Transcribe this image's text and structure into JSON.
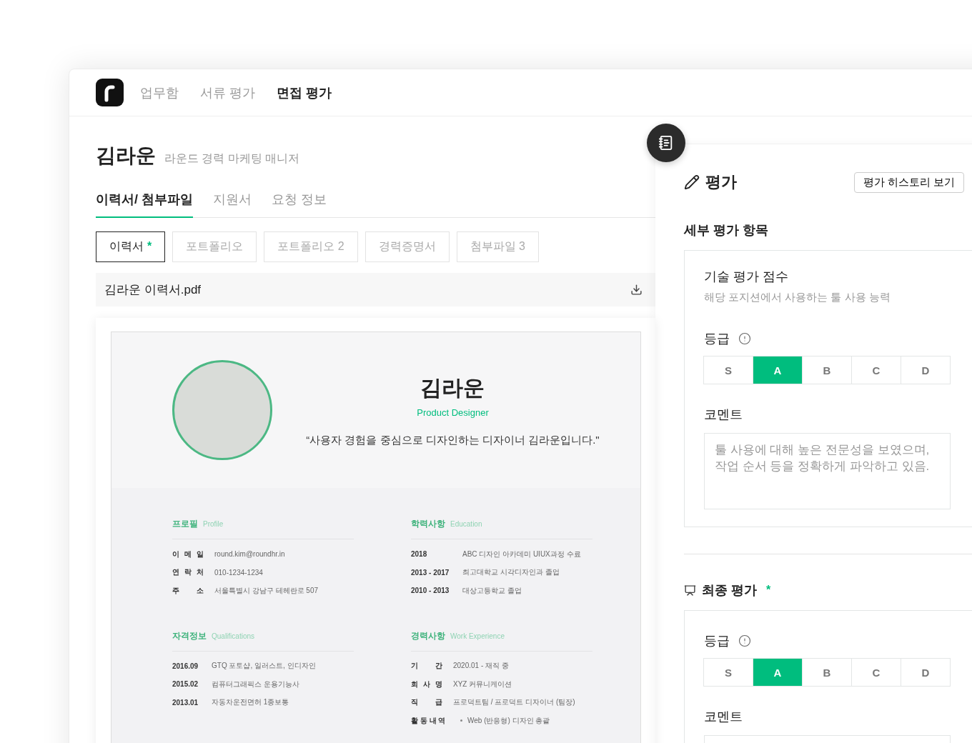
{
  "nav": {
    "items": [
      {
        "label": "업무함",
        "selected": false
      },
      {
        "label": "서류 평가",
        "selected": false
      },
      {
        "label": "면접 평가",
        "selected": true
      }
    ]
  },
  "candidate": {
    "name": "김라운",
    "subtitle": "라운드 경력 마케팅 매니저"
  },
  "tabs": [
    {
      "label": "이력서/ 첨부파일",
      "selected": true
    },
    {
      "label": "지원서",
      "selected": false
    },
    {
      "label": "요청 정보",
      "selected": false
    }
  ],
  "file_tabs": [
    {
      "label": "이력서",
      "required": true,
      "mark": "*",
      "selected": true
    },
    {
      "label": "포트폴리오",
      "required": false,
      "selected": false
    },
    {
      "label": "포트폴리오 2",
      "required": false,
      "selected": false
    },
    {
      "label": "경력증명서",
      "required": false,
      "selected": false
    },
    {
      "label": "첨부파일 3",
      "required": false,
      "selected": false
    }
  ],
  "file": {
    "name": "김라운 이력서.pdf"
  },
  "resume": {
    "name": "김라운",
    "role": "Product Designer",
    "quote": "“사용자 경험을 중심으로 디자인하는 디자이너 김라운입니다.\"",
    "sections": [
      {
        "title": "프로필",
        "subtitle": "Profile",
        "kind": "spaced",
        "rows": [
          {
            "label": "이 메 일",
            "value": "round.kim@roundhr.in"
          },
          {
            "label": "연 락 처",
            "value": "010-1234-1234"
          },
          {
            "label": "주 소",
            "value": "서울특별시 강남구 테헤란로 507"
          }
        ]
      },
      {
        "title": "학력사항",
        "subtitle": "Education",
        "kind": "dated",
        "rows": [
          {
            "label": "2018",
            "value": "ABC 디자인 아카데미 UIUX과정 수료"
          },
          {
            "label": "2013 - 2017",
            "value": "최고대학교 시각디자인과 졸업"
          },
          {
            "label": "2010 - 2013",
            "value": "대상고등학교 졸업"
          }
        ]
      },
      {
        "title": "자격정보",
        "subtitle": "Qualifications",
        "kind": "dated",
        "rows": [
          {
            "label": "2016.09",
            "value": "GTQ 포토샵, 일러스트, 인디자인"
          },
          {
            "label": "2015.02",
            "value": "컴퓨터그래픽스 운용기능사"
          },
          {
            "label": "2013.01",
            "value": "자동차운전면허 1종보통"
          }
        ]
      },
      {
        "title": "경력사항",
        "subtitle": "Work Experience",
        "kind": "spaced",
        "rows": [
          {
            "label": "기 간",
            "value": "2020.01 - 재직 중"
          },
          {
            "label": "회 사 명",
            "value": "XYZ 커뮤니케이션"
          },
          {
            "label": "직 급",
            "value": "프로덕트팀 / 프로덕트 디자이너 (팀장)"
          },
          {
            "label": "활 동 내 역",
            "bullets": [
              "Web (반응형) 디자인 총괄"
            ]
          }
        ]
      }
    ]
  },
  "evaluation": {
    "title": "평가",
    "history_button": "평가 히스토리 보기",
    "detail_heading": "세부 평가 항목",
    "criteria": [
      {
        "title": "기술 평가 점수",
        "description": "해당 포지션에서 사용하는 툴 사용 능력",
        "grade_label": "등급",
        "grades": [
          {
            "label": "S",
            "selected": false
          },
          {
            "label": "A",
            "selected": true
          },
          {
            "label": "B",
            "selected": false
          },
          {
            "label": "C",
            "selected": false
          },
          {
            "label": "D",
            "selected": false
          }
        ],
        "comment_label": "코멘트",
        "comment": "툴 사용에 대해 높은 전문성을 보였으며, 작업 순서 등을 정확하게 파악하고 있음."
      }
    ],
    "final": {
      "title": "최종 평가",
      "required": true,
      "mark": "*",
      "grade_label": "등급",
      "grades": [
        {
          "label": "S",
          "selected": false
        },
        {
          "label": "A",
          "selected": true
        },
        {
          "label": "B",
          "selected": false
        },
        {
          "label": "C",
          "selected": false
        },
        {
          "label": "D",
          "selected": false
        }
      ],
      "comment_label": "코멘트"
    }
  }
}
